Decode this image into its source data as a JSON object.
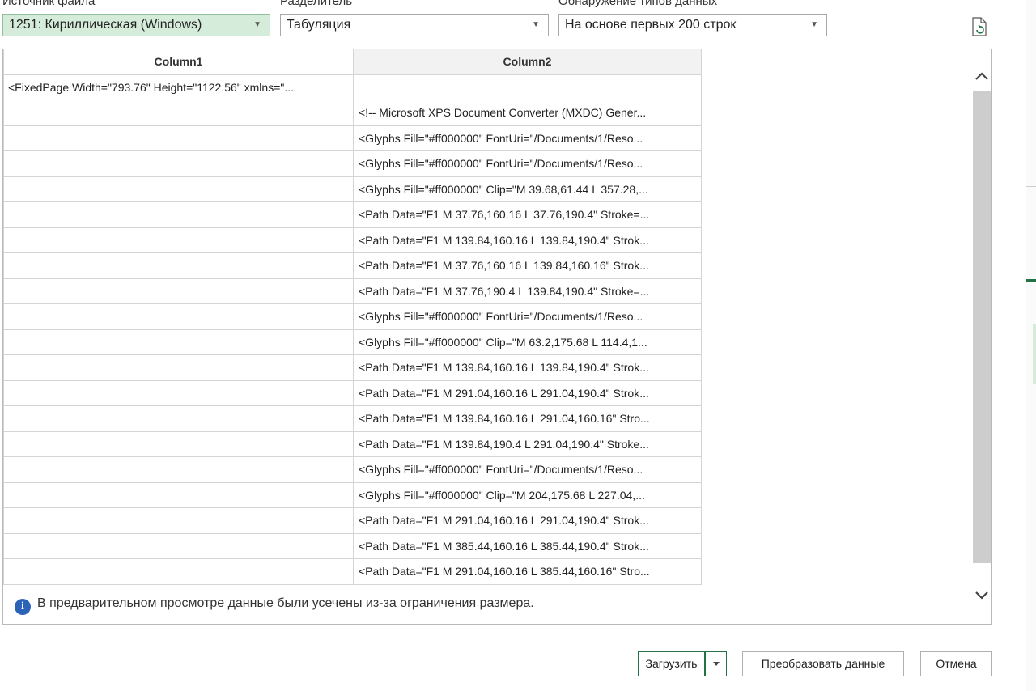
{
  "controls": {
    "file_origin": {
      "label": "Источник файла",
      "value": "1251: Кириллическая (Windows)"
    },
    "delimiter": {
      "label": "Разделитель",
      "value": "Табуляция"
    },
    "type_detection": {
      "label": "Обнаружение типов данных",
      "value": "На основе первых 200 строк"
    }
  },
  "table": {
    "columns": [
      "Column1",
      "Column2"
    ],
    "rows": [
      [
        "<FixedPage Width=\"793.76\" Height=\"1122.56\" xmlns=\"...",
        ""
      ],
      [
        "",
        "<!-- Microsoft XPS Document Converter (MXDC) Gener..."
      ],
      [
        "",
        "<Glyphs Fill=\"#ff000000\" FontUri=\"/Documents/1/Reso..."
      ],
      [
        "",
        "<Glyphs Fill=\"#ff000000\" FontUri=\"/Documents/1/Reso..."
      ],
      [
        "",
        "<Glyphs Fill=\"#ff000000\" Clip=\"M 39.68,61.44 L 357.28,..."
      ],
      [
        "",
        "<Path Data=\"F1 M 37.76,160.16 L 37.76,190.4\" Stroke=..."
      ],
      [
        "",
        "<Path Data=\"F1 M 139.84,160.16 L 139.84,190.4\" Strok..."
      ],
      [
        "",
        "<Path Data=\"F1 M 37.76,160.16 L 139.84,160.16\" Strok..."
      ],
      [
        "",
        "<Path Data=\"F1 M 37.76,190.4 L 139.84,190.4\" Stroke=..."
      ],
      [
        "",
        "<Glyphs Fill=\"#ff000000\" FontUri=\"/Documents/1/Reso..."
      ],
      [
        "",
        "<Glyphs Fill=\"#ff000000\" Clip=\"M 63.2,175.68 L 114.4,1..."
      ],
      [
        "",
        "<Path Data=\"F1 M 139.84,160.16 L 139.84,190.4\" Strok..."
      ],
      [
        "",
        "<Path Data=\"F1 M 291.04,160.16 L 291.04,190.4\" Strok..."
      ],
      [
        "",
        "<Path Data=\"F1 M 139.84,160.16 L 291.04,160.16\" Stro..."
      ],
      [
        "",
        "<Path Data=\"F1 M 139.84,190.4 L 291.04,190.4\" Stroke..."
      ],
      [
        "",
        "<Glyphs Fill=\"#ff000000\" FontUri=\"/Documents/1/Reso..."
      ],
      [
        "",
        "<Glyphs Fill=\"#ff000000\" Clip=\"M 204,175.68 L 227.04,..."
      ],
      [
        "",
        "<Path Data=\"F1 M 291.04,160.16 L 291.04,190.4\" Strok..."
      ],
      [
        "",
        "<Path Data=\"F1 M 385.44,160.16 L 385.44,190.4\" Strok..."
      ],
      [
        "",
        "<Path Data=\"F1 M 291.04,160.16 L 385.44,160.16\" Stro..."
      ]
    ]
  },
  "notice": "В предварительном просмотре данные были усечены из-за ограничения размера.",
  "buttons": {
    "load": "Загрузить",
    "transform": "Преобразовать данные",
    "cancel": "Отмена"
  },
  "icons": {
    "dropdown": "chevron-down-icon",
    "refresh": "refresh-document-icon",
    "info": "info-icon",
    "scroll_up": "chevron-up-icon",
    "scroll_down": "chevron-down-icon"
  },
  "colors": {
    "selected_dropdown": "#d4ecd9",
    "load_border": "#217346",
    "info": "#2b63b8"
  }
}
